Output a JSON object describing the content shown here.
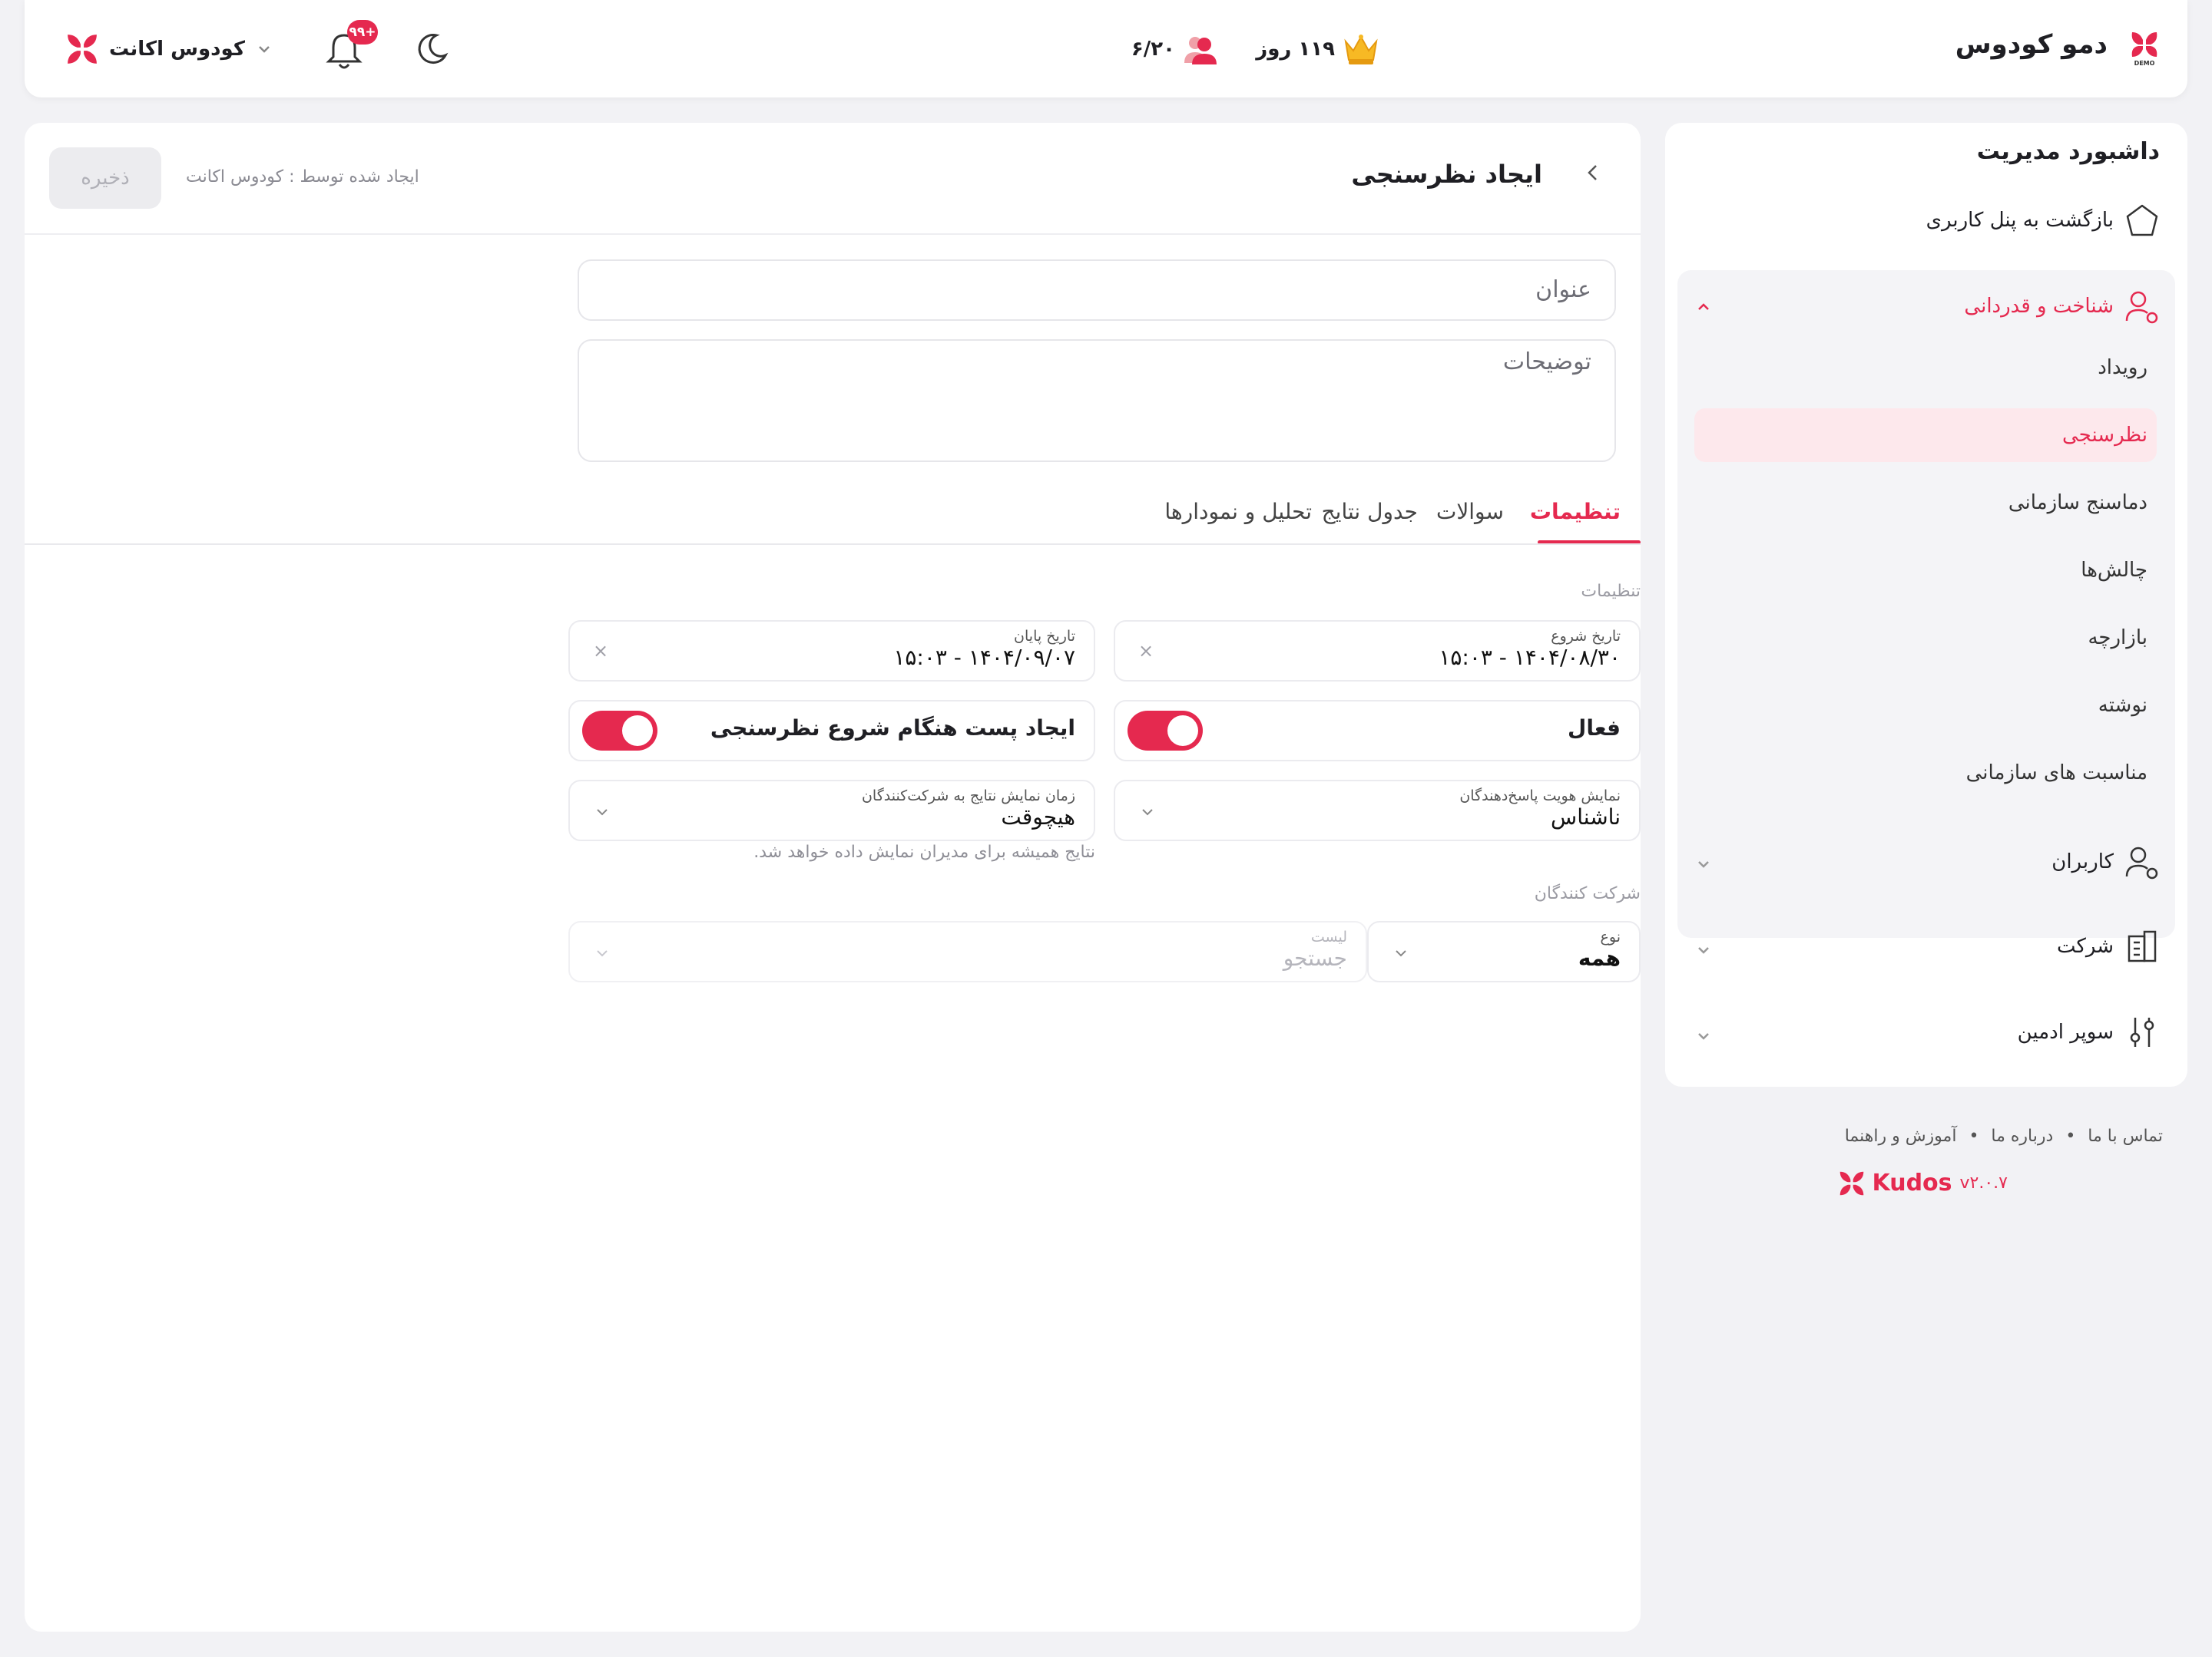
{
  "header": {
    "brand_name": "دمو کودوس",
    "brand_badge": "DEMO",
    "subscription_days": "۱۱۹ روز",
    "user_ratio": "۶/۲۰",
    "notifications_badge": "+۹۹",
    "account_name": "کودوس اکانت"
  },
  "sidebar": {
    "title": "داشبورد مدیریت",
    "back_label": "بازگشت به پنل کاربری",
    "group_label": "شناخت و قدردانی",
    "sub_items": [
      "رویداد",
      "نظرسنجی",
      "دماسنج سازمانی",
      "چالش‌ها",
      "بازارچه",
      "نوشته",
      "مناسبت های سازمانی"
    ],
    "active_sub_item": "نظرسنجی",
    "users_label": "کاربران",
    "company_label": "شرکت",
    "super_admin_label": "سوپر ادمین"
  },
  "footer": {
    "links": [
      "تماس با ما",
      "درباره ما",
      "آموزش و راهنما"
    ],
    "separator": "•",
    "brand": "Kudos",
    "version": "v۲.۰.۷"
  },
  "page": {
    "title": "ایجاد نظرسنجی",
    "created_by": "ایجاد شده توسط : کودوس اکانت",
    "save_label": "ذخیره",
    "title_placeholder": "عنوان",
    "description_placeholder": "توضیحات"
  },
  "tabs": [
    "تنظیمات",
    "سوالات",
    "جدول نتایج",
    "تحلیل و نمودارها"
  ],
  "active_tab": "تنظیمات",
  "settings": {
    "section_label": "تنظیمات",
    "start_date_label": "تاریخ شروع",
    "start_date_value": "۱۴۰۴/۰۸/۳۰ - ۱۵:۰۳",
    "end_date_label": "تاریخ پایان",
    "end_date_value": "۱۴۰۴/۰۹/۰۷ - ۱۵:۰۳",
    "active_label": "فعال",
    "active_on": true,
    "create_post_label": "ایجاد پست هنگام شروع نظرسنجی",
    "create_post_on": true,
    "identity_label": "نمایش هویت پاسخ‌دهندگان",
    "identity_value": "ناشناس",
    "results_time_label": "زمان نمایش نتایج به شرکت‌کنندگان",
    "results_time_value": "هیچوقت",
    "results_hint": "نتایج همیشه برای مدیران نمایش داده خواهد شد.",
    "clear_symbol": "×"
  },
  "participants": {
    "section_label": "شرکت کنندگان",
    "type_label": "نوع",
    "type_value": "همه",
    "list_label": "لیست",
    "list_placeholder": "جستجو"
  },
  "colors": {
    "accent": "#e5294f",
    "active_bg": "#fde8ec",
    "page_bg": "#f2f2f5"
  }
}
